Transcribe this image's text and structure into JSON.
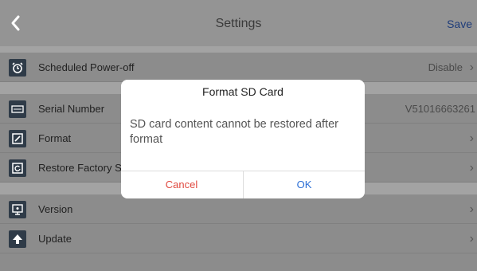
{
  "header": {
    "back_icon": "chevron-left-icon",
    "title": "Settings",
    "save_label": "Save"
  },
  "rows": [
    {
      "icon": "alarm-clock-icon",
      "label": "Scheduled Power-off",
      "value": "Disable"
    },
    {
      "icon": "serial-number-icon",
      "label": "Serial Number",
      "value": "V51016663261"
    },
    {
      "icon": "format-icon",
      "label": "Format",
      "value": ""
    },
    {
      "icon": "restore-icon",
      "label": "Restore Factory Settings",
      "value": ""
    },
    {
      "icon": "version-icon",
      "label": "Version",
      "value": ""
    },
    {
      "icon": "upload-arrow-icon",
      "label": "Update",
      "value": ""
    }
  ],
  "dialog": {
    "title": "Format SD Card",
    "message": "SD card content cannot be restored after format",
    "cancel_label": "Cancel",
    "ok_label": "OK"
  },
  "colors": {
    "overlay_bg": "#8c8c8c",
    "dialog_bg": "#ffffff",
    "cancel": "#e0493f",
    "ok": "#2c6fd6"
  }
}
